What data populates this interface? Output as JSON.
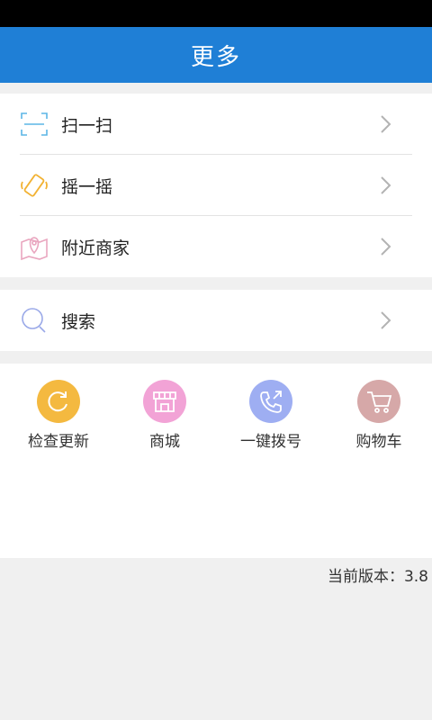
{
  "header": {
    "title": "更多"
  },
  "menu_group_1": [
    {
      "label": "扫一扫",
      "icon": "scan-icon"
    },
    {
      "label": "摇一摇",
      "icon": "shake-phone-icon"
    },
    {
      "label": "附近商家",
      "icon": "map-pin-icon"
    }
  ],
  "menu_group_2": [
    {
      "label": "搜索",
      "icon": "search-icon"
    }
  ],
  "quick_actions": [
    {
      "label": "检查更新",
      "icon": "refresh-icon",
      "color": "#f4b940"
    },
    {
      "label": "商城",
      "icon": "store-icon",
      "color": "#f2a3d6"
    },
    {
      "label": "一键拨号",
      "icon": "phone-icon",
      "color": "#9eaef2"
    },
    {
      "label": "购物车",
      "icon": "cart-icon",
      "color": "#d6a8a8"
    }
  ],
  "footer": {
    "version_text": "当前版本：3.8"
  },
  "colors": {
    "header_bg": "#1f7fd6",
    "page_bg": "#f0f0f0"
  }
}
